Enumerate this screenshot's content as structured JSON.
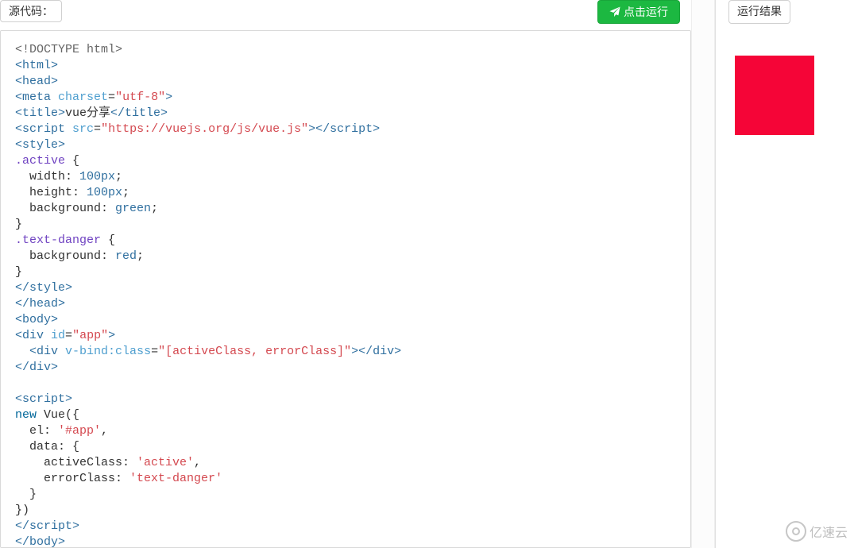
{
  "header": {
    "source_label": "源代码：",
    "run_button": "点击运行",
    "result_label": "运行结果"
  },
  "watermark": {
    "text": "亿速云"
  },
  "chart_data": {
    "type": "table",
    "note": "not-a-chart"
  },
  "code": {
    "doctype": "<!DOCTYPE html>",
    "html_open": "<html>",
    "head_open": "<head>",
    "meta_open": "<meta",
    "meta_attr": "charset",
    "meta_eq": "=",
    "meta_val": "\"utf-8\"",
    "meta_close": ">",
    "title_open": "<title>",
    "title_text": "vue分享",
    "title_close": "</title>",
    "script_open": "<script",
    "script_attr": "src",
    "script_eq": "=",
    "script_val": "\"https://vuejs.org/js/vue.js\"",
    "script_mid": ">",
    "script_close_tag": "</script>",
    "style_open": "<style>",
    "sel_active": ".active",
    "brace_open": " {",
    "prop_width": "  width: ",
    "val_100px_a": "100px",
    "semi": ";",
    "prop_height": "  height: ",
    "val_100px_b": "100px",
    "prop_bg": "  background: ",
    "val_green": "green",
    "brace_close": "}",
    "sel_textdanger": ".text-danger",
    "val_red": "red",
    "style_close": "</style>",
    "head_close": "</head>",
    "body_open": "<body>",
    "div_open1": "<div",
    "id_attr": "id",
    "id_eq": "=",
    "id_val": "\"app\"",
    "div_close1": ">",
    "indent2": "  ",
    "div_open2": "<div",
    "vbind_attr": "v-bind:class",
    "vbind_eq": "=",
    "vbind_val": "\"[activeClass, errorClass]\"",
    "div_mid2": ">",
    "div_close2": "</div>",
    "div_closeouter": "</div>",
    "script2_open": "<script>",
    "new_kw": "new",
    "vue_call": " Vue({",
    "el_line_key": "  el: ",
    "el_line_val": "'#app'",
    "comma": ",",
    "data_line": "  data: {",
    "ac_key": "    activeClass: ",
    "ac_val": "'active'",
    "ec_key": "    errorClass: ",
    "ec_val": "'text-danger'",
    "data_close": "  }",
    "vue_close": "})",
    "script2_close": "</script>",
    "body_close": "</body>"
  }
}
